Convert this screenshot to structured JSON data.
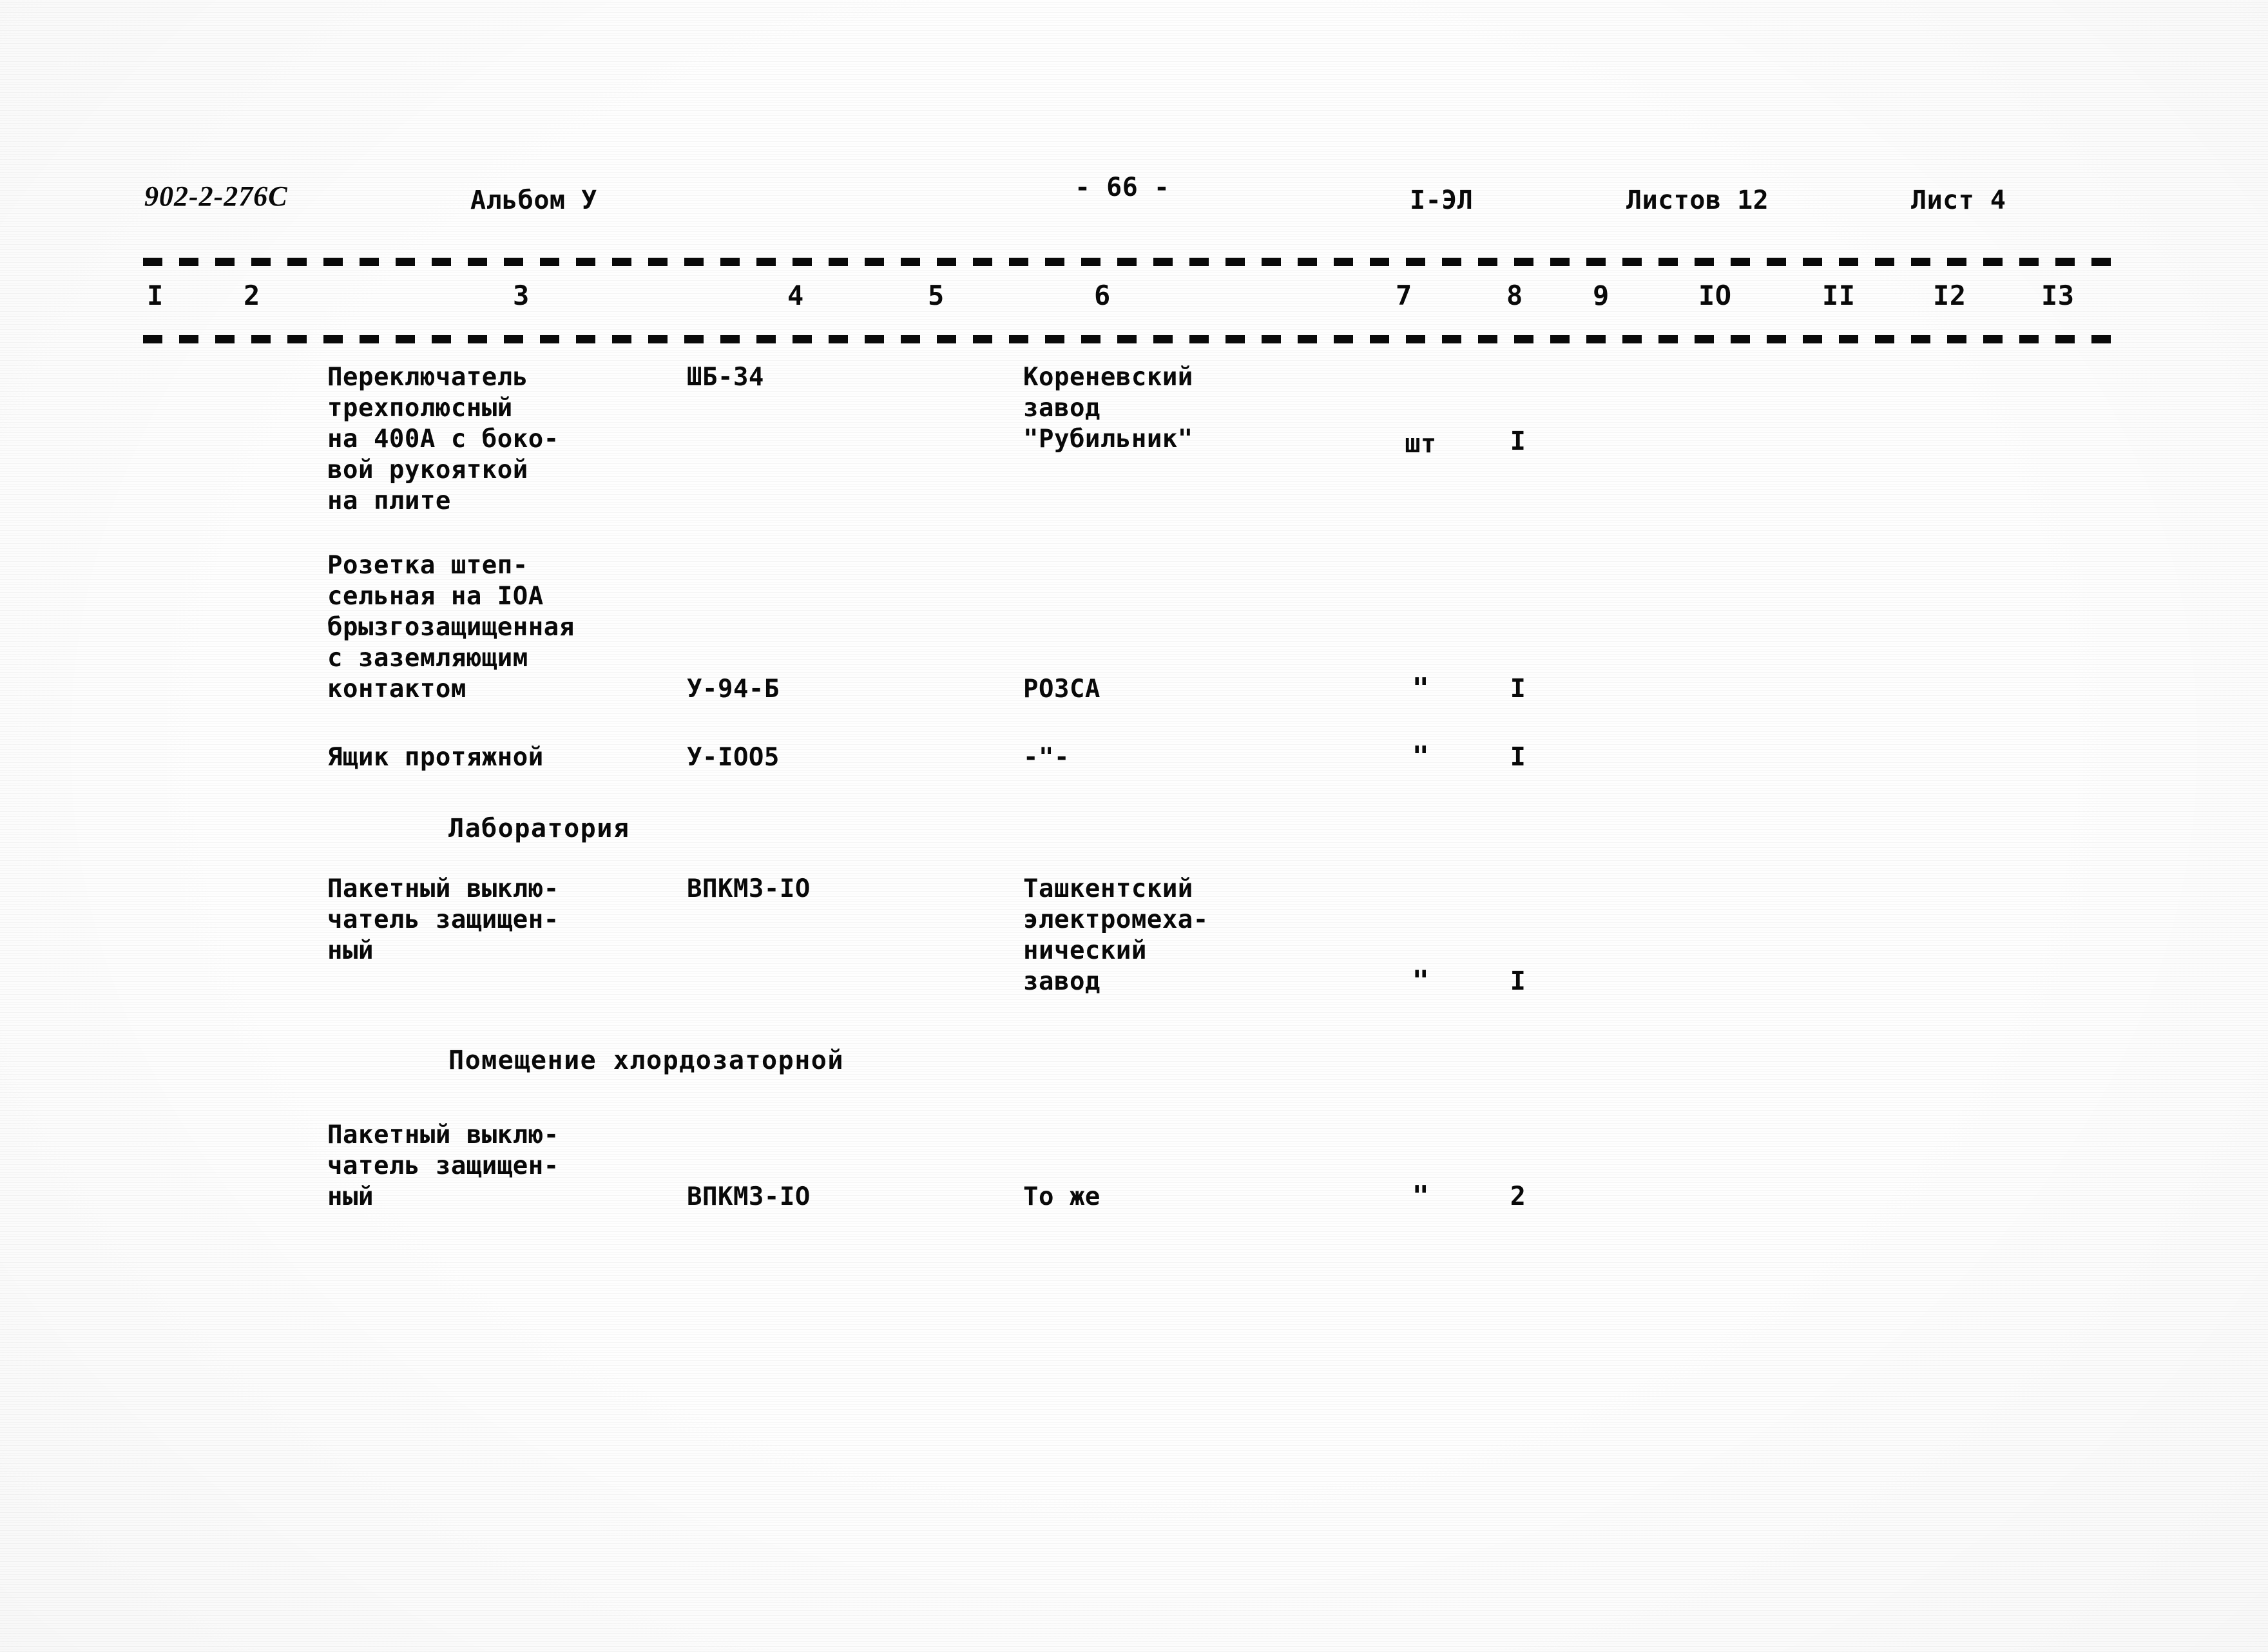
{
  "document": {
    "project_code": "902-2-276С",
    "album": "Альбом У",
    "page_number": "- 66 -",
    "mark": "I-ЭЛ",
    "sheets_total": "Листов 12",
    "sheet_current": "Лист 4"
  },
  "table": {
    "column_numbers": [
      "I",
      "2",
      "3",
      "4",
      "5",
      "6",
      "7",
      "8",
      "9",
      "IO",
      "II",
      "I2",
      "I3"
    ],
    "rows": [
      {
        "name_lines": [
          "Переключатель",
          "трехполюсный",
          "на 400А с боко-",
          "вой рукояткой",
          "на плите"
        ],
        "type": "ШБ-34",
        "manufacturer_lines": [
          "Кореневский",
          "завод",
          "\"Рубильник\""
        ],
        "unit": "шт",
        "quantity": "I"
      },
      {
        "name_lines": [
          "Розетка штеп-",
          "сельная на IOA",
          "брызгозащищенная",
          "с заземляющим",
          "контактом"
        ],
        "type": "У-94-Б",
        "manufacturer_lines": [
          "РОЗСА"
        ],
        "unit": "\"",
        "quantity": "I"
      },
      {
        "name_lines": [
          "Ящик протяжной"
        ],
        "type": "У-IOO5",
        "manufacturer_lines": [
          "-\"-"
        ],
        "unit": "\"",
        "quantity": "I"
      }
    ],
    "section_laboratory": {
      "title": "Лаборатория",
      "rows": [
        {
          "name_lines": [
            "Пакетный выклю-",
            "чатель защищен-",
            "ный"
          ],
          "type": "ВПКМ3-IO",
          "manufacturer_lines": [
            "Ташкентский",
            "электромеха-",
            "нический",
            "завод"
          ],
          "unit": "\"",
          "quantity": "I"
        }
      ]
    },
    "section_chlorination": {
      "title": "Помещение хлордозаторной",
      "rows": [
        {
          "name_lines": [
            "Пакетный выклю-",
            "чатель защищен-",
            "ный"
          ],
          "type": "ВПКМ3-IO",
          "manufacturer_lines": [
            "То же"
          ],
          "unit": "\"",
          "quantity": "2"
        }
      ]
    }
  },
  "colors": {
    "ink": "#0a0a0a",
    "paper": "#fefefe"
  }
}
